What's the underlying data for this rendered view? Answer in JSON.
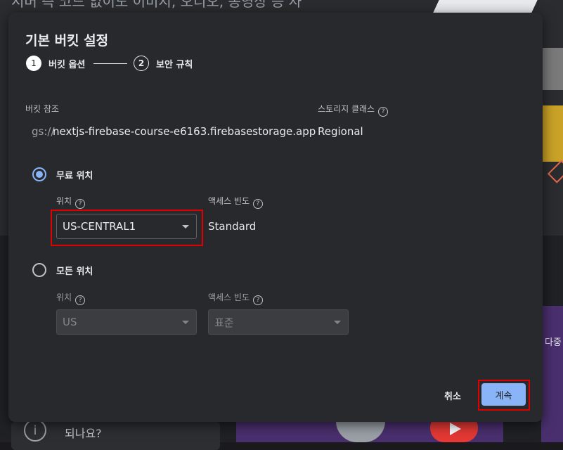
{
  "background": {
    "heading": "서버 측 코드 없이도 이미지, 오디오, 동영상 등 사",
    "info_text": "되나요?",
    "right_text": "다중"
  },
  "dialog": {
    "title": "기본 버킷 설정",
    "steps": [
      {
        "number": "1",
        "label": "버킷 옵션",
        "state": "active"
      },
      {
        "number": "2",
        "label": "보안 규칙",
        "state": "pending"
      }
    ],
    "bucket_ref_label": "버킷 참조",
    "bucket_ref_prefix": "gs://",
    "bucket_ref_value": "nextjs-firebase-course-e6163.firebasestorage.app",
    "storage_class_label": "스토리지 클래스",
    "storage_class_value": "Regional",
    "free_location": {
      "label": "무료 위치",
      "selected": true,
      "location_label": "위치",
      "location_value": "US-CENTRAL1",
      "access_freq_label": "액세스 빈도",
      "access_freq_value": "Standard"
    },
    "all_locations": {
      "label": "모든 위치",
      "selected": false,
      "location_label": "위치",
      "location_value": "US",
      "access_freq_label": "액세스 빈도",
      "access_freq_value": "표준"
    },
    "buttons": {
      "cancel": "취소",
      "continue": "계속"
    }
  },
  "colors": {
    "accent": "#8ab4f8",
    "highlight": "#e00000",
    "dialog_bg": "#28292c"
  }
}
